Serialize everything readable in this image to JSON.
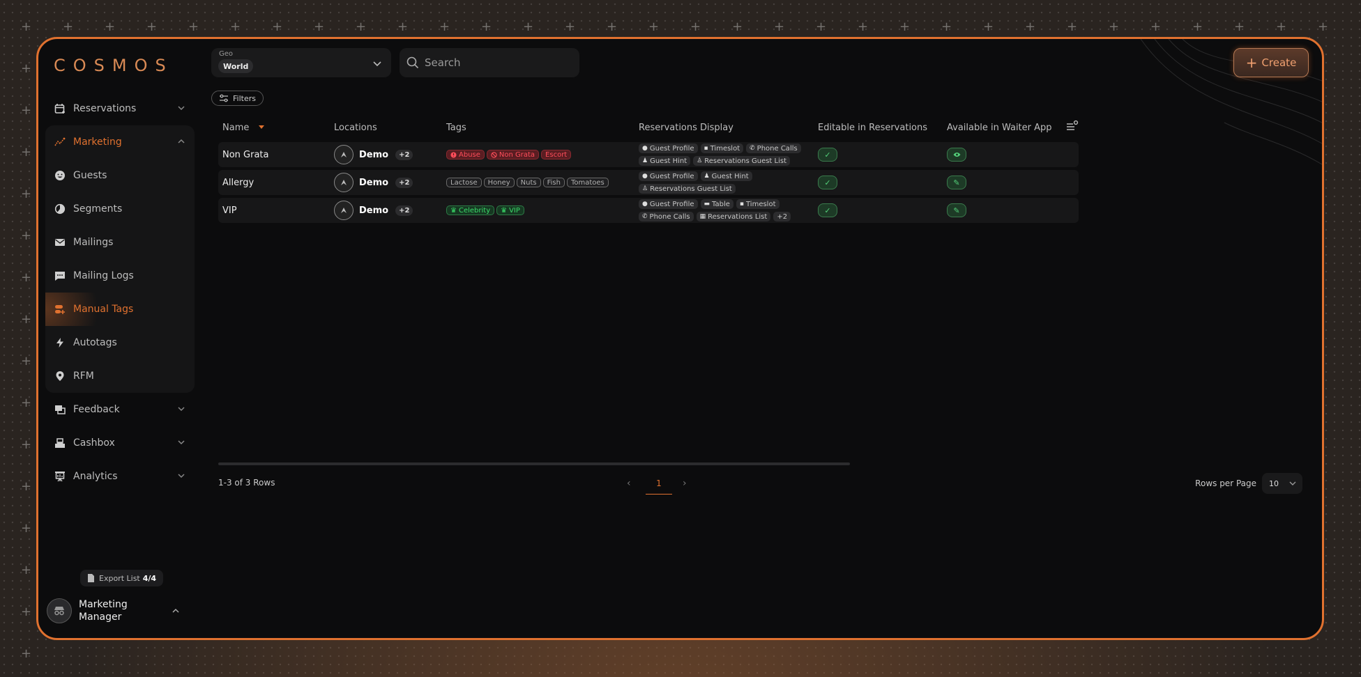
{
  "brand": {
    "logo": "COSMOS",
    "accent": "#e0712f"
  },
  "sidebar": {
    "items": [
      {
        "label": "Reservations",
        "icon": "calendar-plus-icon",
        "expandable": true
      },
      {
        "label": "Marketing",
        "icon": "chart-line-icon",
        "expandable": true,
        "expanded": true
      },
      {
        "label": "Guests",
        "icon": "smiley-icon"
      },
      {
        "label": "Segments",
        "icon": "pie-chart-icon"
      },
      {
        "label": "Mailings",
        "icon": "mail-icon"
      },
      {
        "label": "Mailing Logs",
        "icon": "message-icon"
      },
      {
        "label": "Manual Tags",
        "icon": "tag-icon",
        "selected": true
      },
      {
        "label": "Autotags",
        "icon": "lightning-icon"
      },
      {
        "label": "RFM",
        "icon": "location-pin-icon"
      },
      {
        "label": "Feedback",
        "icon": "feedback-icon",
        "expandable": true
      },
      {
        "label": "Cashbox",
        "icon": "cashbox-icon",
        "expandable": true
      },
      {
        "label": "Analytics",
        "icon": "presentation-icon",
        "expandable": true
      }
    ],
    "export": {
      "label": "Export List",
      "count": "4/4"
    },
    "user": {
      "name": "Marketing Manager"
    }
  },
  "toolbar": {
    "geo_label": "Geo",
    "geo_value": "World",
    "search_placeholder": "Search",
    "create_label": "Create",
    "filters_label": "Filters"
  },
  "table": {
    "columns": [
      "Name",
      "Locations",
      "Tags",
      "Reservations Display",
      "Editable in Reservations",
      "Available in Waiter App"
    ],
    "rows": [
      {
        "name": "Non Grata",
        "location": "Demo",
        "location_more": "+2",
        "tags": [
          {
            "label": "Abuse",
            "style": "red",
            "icon": "alert-circle-icon"
          },
          {
            "label": "Non Grata",
            "style": "red",
            "icon": "ban-icon"
          },
          {
            "label": "Escort",
            "style": "red"
          }
        ],
        "display": [
          {
            "label": "Guest Profile",
            "icon": "user-circle-icon"
          },
          {
            "label": "Timeslot",
            "icon": "note-icon"
          },
          {
            "label": "Phone Calls",
            "icon": "phone-icon"
          },
          {
            "label": "Guest Hint",
            "icon": "users-icon"
          },
          {
            "label": "Reservations Guest List",
            "icon": "person-icon"
          }
        ],
        "editable_icon": "check-icon",
        "waiter_icon": "eye-icon"
      },
      {
        "name": "Allergy",
        "location": "Demo",
        "location_more": "+2",
        "tags": [
          {
            "label": "Lactose",
            "style": "grey"
          },
          {
            "label": "Honey",
            "style": "grey"
          },
          {
            "label": "Nuts",
            "style": "grey"
          },
          {
            "label": "Fish",
            "style": "grey"
          },
          {
            "label": "Tomatoes",
            "style": "grey"
          }
        ],
        "display": [
          {
            "label": "Guest Profile",
            "icon": "user-circle-icon"
          },
          {
            "label": "Guest Hint",
            "icon": "users-icon"
          },
          {
            "label": "Reservations Guest List",
            "icon": "person-icon"
          }
        ],
        "editable_icon": "check-icon",
        "waiter_icon": "pencil-icon"
      },
      {
        "name": "VIP",
        "location": "Demo",
        "location_more": "+2",
        "tags": [
          {
            "label": "Celebrity",
            "style": "green",
            "icon": "crown-icon"
          },
          {
            "label": "VIP",
            "style": "green",
            "icon": "crown-icon"
          }
        ],
        "display": [
          {
            "label": "Guest Profile",
            "icon": "user-circle-icon"
          },
          {
            "label": "Table",
            "icon": "table-icon"
          },
          {
            "label": "Timeslot",
            "icon": "note-icon"
          },
          {
            "label": "Phone Calls",
            "icon": "phone-icon"
          },
          {
            "label": "Reservations List",
            "icon": "calendar-icon"
          },
          {
            "label": "+2",
            "icon": ""
          }
        ],
        "editable_icon": "check-icon",
        "waiter_icon": "pencil-icon"
      }
    ]
  },
  "footer": {
    "rows_count": "1-3 of 3 Rows",
    "current_page": "1",
    "rows_per_page_label": "Rows per Page",
    "rows_per_page_value": "10"
  }
}
